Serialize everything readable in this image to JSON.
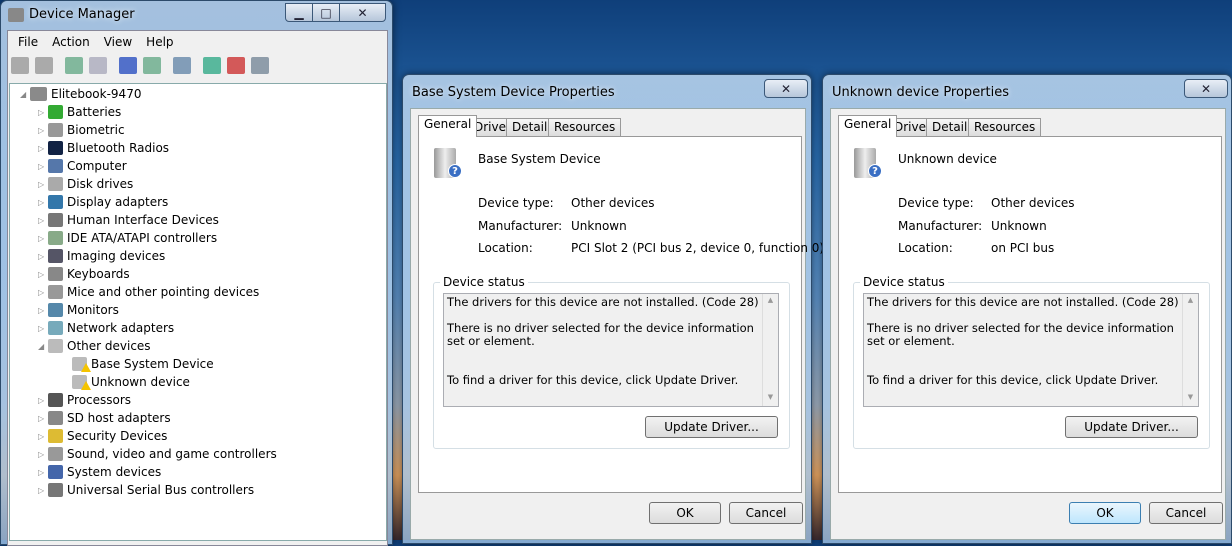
{
  "device_manager": {
    "title": "Device Manager",
    "menu": [
      "File",
      "Action",
      "View",
      "Help"
    ],
    "toolbar_icons": [
      "back-icon",
      "forward-icon",
      "show-hide-tree-icon",
      "properties-icon",
      "help-icon",
      "action-pane-icon",
      "scan-hardware-icon",
      "update-driver-icon",
      "uninstall-icon",
      "disable-icon"
    ],
    "root": "Elitebook-9470",
    "categories": [
      {
        "label": "Batteries",
        "expanded": false
      },
      {
        "label": "Biometric",
        "expanded": false
      },
      {
        "label": "Bluetooth Radios",
        "expanded": false
      },
      {
        "label": "Computer",
        "expanded": false
      },
      {
        "label": "Disk drives",
        "expanded": false
      },
      {
        "label": "Display adapters",
        "expanded": false
      },
      {
        "label": "Human Interface Devices",
        "expanded": false
      },
      {
        "label": "IDE ATA/ATAPI controllers",
        "expanded": false
      },
      {
        "label": "Imaging devices",
        "expanded": false
      },
      {
        "label": "Keyboards",
        "expanded": false
      },
      {
        "label": "Mice and other pointing devices",
        "expanded": false
      },
      {
        "label": "Monitors",
        "expanded": false
      },
      {
        "label": "Network adapters",
        "expanded": false
      },
      {
        "label": "Other devices",
        "expanded": true,
        "children": [
          "Base System Device",
          "Unknown device"
        ]
      },
      {
        "label": "Processors",
        "expanded": false
      },
      {
        "label": "SD host adapters",
        "expanded": false
      },
      {
        "label": "Security Devices",
        "expanded": false
      },
      {
        "label": "Sound, video and game controllers",
        "expanded": false
      },
      {
        "label": "System devices",
        "expanded": false
      },
      {
        "label": "Universal Serial Bus controllers",
        "expanded": false
      }
    ]
  },
  "dialogs": [
    {
      "title": "Base System Device Properties",
      "tabs": [
        "General",
        "Driver",
        "Details",
        "Resources"
      ],
      "device_name": "Base System Device",
      "props": [
        [
          "Device type:",
          "Other devices"
        ],
        [
          "Manufacturer:",
          "Unknown"
        ],
        [
          "Location:",
          "PCI Slot 2 (PCI bus 2, device 0, function 0)"
        ]
      ],
      "status_label": "Device status",
      "status_lines": [
        "The drivers for this device are not installed. (Code 28)",
        "There is no driver selected for the device information set or element.",
        "To find a driver for this device, click Update Driver."
      ],
      "update_driver": "Update Driver...",
      "ok": "OK",
      "cancel": "Cancel"
    },
    {
      "title": "Unknown device Properties",
      "tabs": [
        "General",
        "Driver",
        "Details",
        "Resources"
      ],
      "device_name": "Unknown device",
      "props": [
        [
          "Device type:",
          "Other devices"
        ],
        [
          "Manufacturer:",
          "Unknown"
        ],
        [
          "Location:",
          "on PCI bus"
        ]
      ],
      "status_label": "Device status",
      "status_lines": [
        "The drivers for this device are not installed. (Code 28)",
        "There is no driver selected for the device information set or element.",
        "To find a driver for this device, click Update Driver."
      ],
      "update_driver": "Update Driver...",
      "ok": "OK",
      "cancel": "Cancel"
    }
  ]
}
